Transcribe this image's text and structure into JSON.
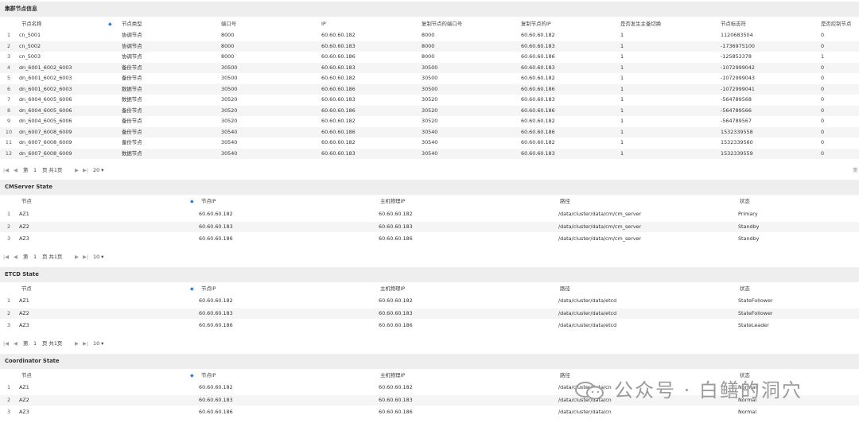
{
  "cluster": {
    "title": "集群节点信息",
    "headers": [
      "节点名称",
      "节点类型",
      "端口号",
      "IP",
      "复制节点的端口号",
      "复制节点的IP",
      "是否发生主备切换",
      "节点标志符",
      "是否控制节点"
    ],
    "rows": [
      [
        "1",
        "cn_5001",
        "协调节点",
        "8000",
        "60.60.60.182",
        "8000",
        "60.60.60.182",
        "1",
        "1120683504",
        "0"
      ],
      [
        "2",
        "cn_5002",
        "协调节点",
        "8000",
        "60.60.60.183",
        "8000",
        "60.60.60.183",
        "1",
        "-1736975100",
        "0"
      ],
      [
        "3",
        "cn_5003",
        "协调节点",
        "8000",
        "60.60.60.186",
        "8000",
        "60.60.60.186",
        "1",
        "-125853378",
        "1"
      ],
      [
        "4",
        "dn_6001_6002_6003",
        "备份节点",
        "30500",
        "60.60.60.183",
        "30500",
        "60.60.60.183",
        "1",
        "-1072999042",
        "0"
      ],
      [
        "5",
        "dn_6001_6002_6003",
        "备份节点",
        "30500",
        "60.60.60.182",
        "30500",
        "60.60.60.182",
        "1",
        "-1072999043",
        "0"
      ],
      [
        "6",
        "dn_6001_6002_6003",
        "数据节点",
        "30500",
        "60.60.60.186",
        "30500",
        "60.60.60.186",
        "1",
        "-1072999041",
        "0"
      ],
      [
        "7",
        "dn_6004_6005_6006",
        "数据节点",
        "30520",
        "60.60.60.183",
        "30520",
        "60.60.60.183",
        "1",
        "-564789568",
        "0"
      ],
      [
        "8",
        "dn_6004_6005_6006",
        "备份节点",
        "30520",
        "60.60.60.186",
        "30520",
        "60.60.60.186",
        "1",
        "-564789566",
        "0"
      ],
      [
        "9",
        "dn_6004_6005_6006",
        "备份节点",
        "30520",
        "60.60.60.182",
        "30520",
        "60.60.60.182",
        "1",
        "-564789567",
        "0"
      ],
      [
        "10",
        "dn_6007_6008_6009",
        "备份节点",
        "30540",
        "60.60.60.186",
        "30540",
        "60.60.60.186",
        "1",
        "1532339558",
        "0"
      ],
      [
        "11",
        "dn_6007_6008_6009",
        "备份节点",
        "30540",
        "60.60.60.182",
        "30540",
        "60.60.60.182",
        "1",
        "1532339560",
        "0"
      ],
      [
        "12",
        "dn_6007_6008_6009",
        "数据节点",
        "30540",
        "60.60.60.183",
        "30540",
        "60.60.60.183",
        "1",
        "1532339559",
        "0"
      ]
    ],
    "pager": {
      "first": "|◀",
      "prev": "◀",
      "page_label": "第",
      "page": "1",
      "of": "页 共1页",
      "next": "▶",
      "last": "▶|",
      "size": "20",
      "right": "第"
    }
  },
  "cmserver": {
    "title": "CMServer State",
    "headers": [
      "节点",
      "节点IP",
      "主机物理IP",
      "路径",
      "状态"
    ],
    "rows": [
      [
        "1",
        "AZ1",
        "60.60.60.182",
        "60.60.60.182",
        "/data/cluster/data/cm/cm_server",
        "Primary"
      ],
      [
        "2",
        "AZ2",
        "60.60.60.183",
        "60.60.60.183",
        "/data/cluster/data/cm/cm_server",
        "Standby"
      ],
      [
        "3",
        "AZ3",
        "60.60.60.186",
        "60.60.60.186",
        "/data/cluster/data/cm/cm_server",
        "Standby"
      ]
    ],
    "pager": {
      "first": "|◀",
      "prev": "◀",
      "page_label": "第",
      "page": "1",
      "of": "页 共1页",
      "next": "▶",
      "last": "▶|",
      "size": "10"
    }
  },
  "etcd": {
    "title": "ETCD State",
    "headers": [
      "节点",
      "节点IP",
      "主机物理IP",
      "路径",
      "状态"
    ],
    "rows": [
      [
        "1",
        "AZ1",
        "60.60.60.182",
        "60.60.60.182",
        "/data/cluster/data/etcd",
        "StateFollower"
      ],
      [
        "2",
        "AZ2",
        "60.60.60.183",
        "60.60.60.183",
        "/data/cluster/data/etcd",
        "StateFollower"
      ],
      [
        "3",
        "AZ3",
        "60.60.60.186",
        "60.60.60.186",
        "/data/cluster/data/etcd",
        "StateLeader"
      ]
    ],
    "pager": {
      "first": "|◀",
      "prev": "◀",
      "page_label": "第",
      "page": "1",
      "of": "页 共1页",
      "next": "▶",
      "last": "▶|",
      "size": "10"
    }
  },
  "coordinator": {
    "title": "Coordinator State",
    "headers": [
      "节点",
      "节点IP",
      "主机物理IP",
      "路径",
      "状态"
    ],
    "rows": [
      [
        "1",
        "AZ1",
        "60.60.60.182",
        "60.60.60.182",
        "/data/cluster/data/cn",
        "Normal"
      ],
      [
        "2",
        "AZ2",
        "60.60.60.183",
        "60.60.60.183",
        "/data/cluster/data/cn",
        "Normal"
      ],
      [
        "3",
        "AZ3",
        "60.60.60.186",
        "60.60.60.186",
        "/data/cluster/data/cn",
        "Normal"
      ]
    ]
  },
  "watermark": {
    "text": "公众号 · 白鳝的洞穴",
    "icon": "wechat-icon"
  },
  "colors": {
    "header_bg": "#eeeeee",
    "alt_row": "#f5f5f5",
    "sort_icon": "#2b7bd6"
  }
}
